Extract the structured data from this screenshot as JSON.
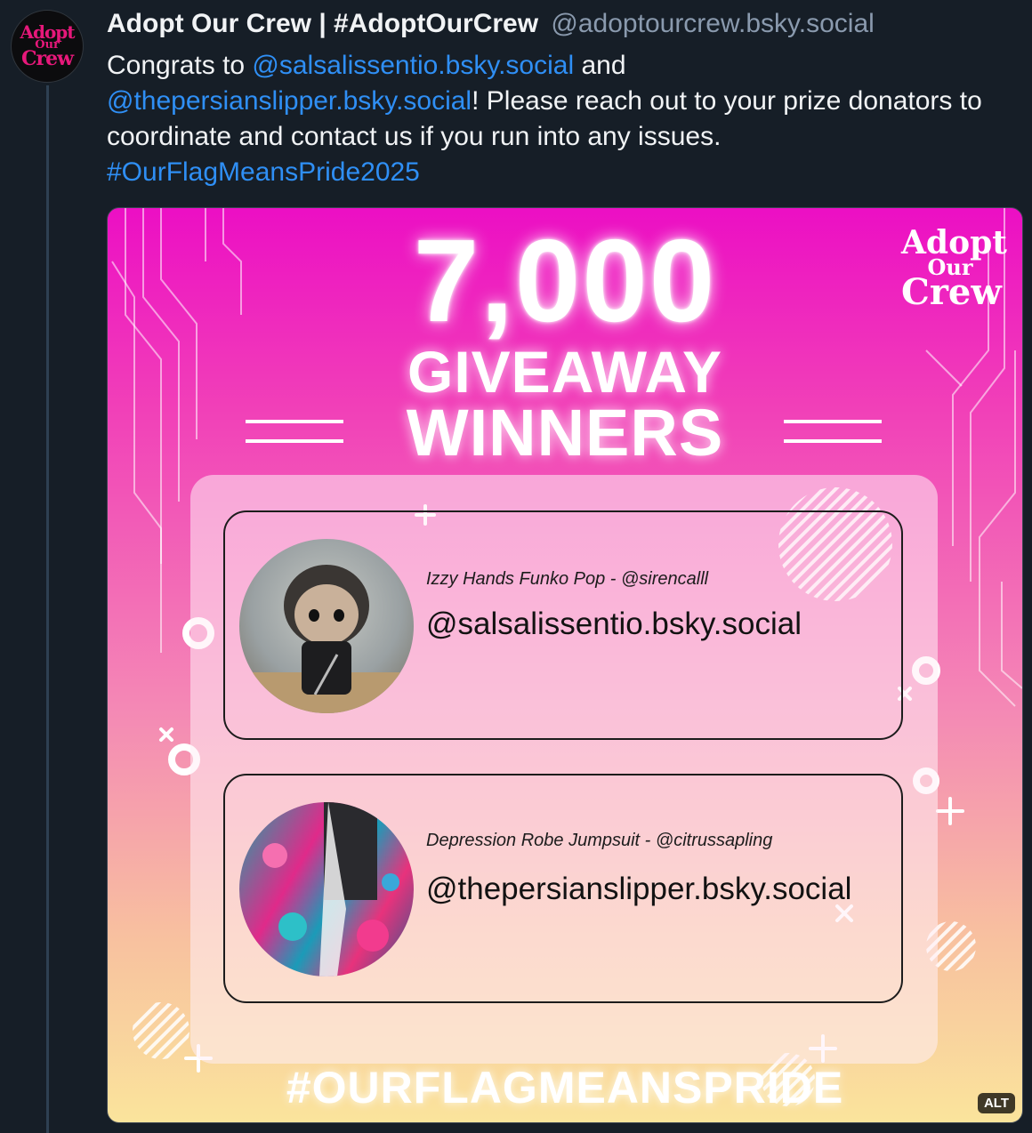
{
  "post": {
    "avatar_text": {
      "line1": "Adopt",
      "line2": "Our",
      "line3": "Crew"
    },
    "display_name": "Adopt Our Crew | #AdoptOurCrew",
    "handle": "@adoptourcrew.bsky.social",
    "text": {
      "part1": "Congrats to ",
      "mention1": "@salsalissentio.bsky.social",
      "part2": " and",
      "mention2": "@thepersianslipper.bsky.social",
      "part3": "! Please reach out to your prize donators to coordinate and contact us if you run into any issues.",
      "hashtag": "#OurFlagMeansPride2025"
    }
  },
  "image": {
    "headline_number": "7,000",
    "headline_line2": "GIVEAWAY",
    "headline_line3": "WINNERS",
    "logo": {
      "line1": "Adopt",
      "line2": "Our",
      "line3": "Crew"
    },
    "winners": [
      {
        "prize": "Izzy Hands Funko Pop - @sirencalll",
        "handle": "@salsalissentio.bsky.social"
      },
      {
        "prize": "Depression Robe Jumpsuit - @citrussapling",
        "handle": "@thepersianslipper.bsky.social"
      }
    ],
    "bottom_hashtag": "#OURFLAGMEANSPRIDE",
    "alt_label": "ALT"
  }
}
